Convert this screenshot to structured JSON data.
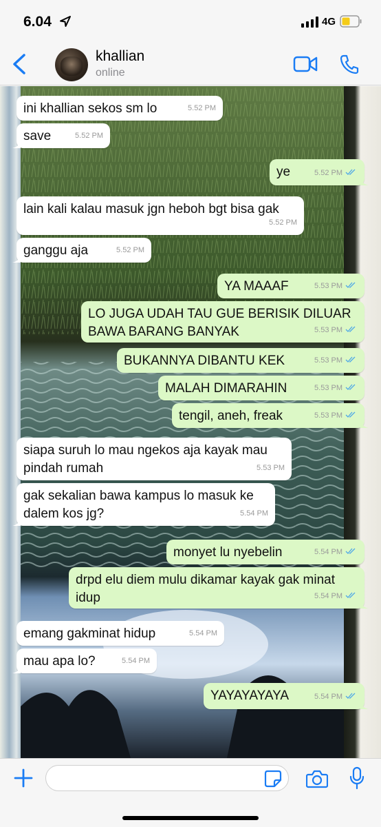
{
  "status_bar": {
    "time": "6.04",
    "network": "4G",
    "location_icon": "location-arrow-icon",
    "signal_icon": "signal-bars-icon",
    "battery_icon": "battery-low-icon"
  },
  "header": {
    "back_icon": "chevron-left-icon",
    "contact_name": "khallian",
    "contact_status": "online",
    "video_icon": "video-camera-icon",
    "call_icon": "phone-icon"
  },
  "messages": [
    {
      "direction": "in",
      "text": "ini khallian sekos sm lo",
      "time": "5.52 PM"
    },
    {
      "direction": "in",
      "text": "save",
      "time": "5.52 PM"
    },
    {
      "direction": "out",
      "text": "ye",
      "time": "5.52 PM"
    },
    {
      "direction": "in",
      "text": "lain kali kalau masuk jgn heboh bgt bisa gak",
      "time": "5.52 PM"
    },
    {
      "direction": "in",
      "text": "ganggu aja",
      "time": "5.52 PM"
    },
    {
      "direction": "out",
      "text": "YA MAAAF",
      "time": "5.53 PM"
    },
    {
      "direction": "out",
      "text": "LO JUGA UDAH TAU GUE BERISIK DILUAR\nBAWA BARANG BANYAK",
      "time": "5.53 PM"
    },
    {
      "direction": "out",
      "text": "BUKANNYA DIBANTU KEK",
      "time": "5.53 PM"
    },
    {
      "direction": "out",
      "text": "MALAH DIMARAHIN",
      "time": "5.53 PM"
    },
    {
      "direction": "out",
      "text": "tengil, aneh, freak",
      "time": "5.53 PM"
    },
    {
      "direction": "in",
      "text": "siapa suruh lo mau ngekos aja kayak mau\npindah rumah",
      "time": "5.53 PM"
    },
    {
      "direction": "in",
      "text": "gak sekalian bawa kampus lo masuk ke\ndalem kos jg?",
      "time": "5.54 PM"
    },
    {
      "direction": "out",
      "text": "monyet lu nyebelin",
      "time": "5.54 PM"
    },
    {
      "direction": "out",
      "text": "drpd elu diem mulu dikamar kayak gak minat\nidup",
      "time": "5.54 PM"
    },
    {
      "direction": "in",
      "text": "emang gakminat hidup",
      "time": "5.54 PM"
    },
    {
      "direction": "in",
      "text": "mau apa lo?",
      "time": "5.54 PM"
    },
    {
      "direction": "out",
      "text": "YAYAYAYAYA",
      "time": "5.54 PM"
    }
  ],
  "input_bar": {
    "plus_icon": "plus-icon",
    "placeholder": "",
    "sticker_icon": "sticker-icon",
    "camera_icon": "camera-icon",
    "mic_icon": "microphone-icon"
  },
  "colors": {
    "accent": "#1a7cf4",
    "outgoing_bubble": "#dcf8c6",
    "incoming_bubble": "#ffffff",
    "read_ticks": "#4fa8e8"
  }
}
